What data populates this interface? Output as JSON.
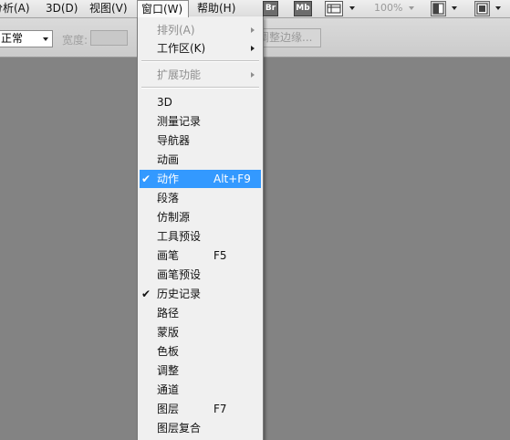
{
  "menubar": {
    "items": [
      {
        "label": "分析(A)"
      },
      {
        "label": "3D(D)"
      },
      {
        "label": "视图(V)"
      },
      {
        "label": "窗口(W)"
      },
      {
        "label": "帮助(H)"
      }
    ],
    "bridge_label": "Br",
    "minibridge_label": "Mb",
    "zoom_value": "100%"
  },
  "optionsbar": {
    "style_value": "正常",
    "width_label": "宽度:",
    "refine_edge_label": "调整边缘..."
  },
  "window_menu": {
    "top_items": [
      {
        "label": "排列(A)",
        "disabled": true,
        "submenu": true
      },
      {
        "label": "工作区(K)",
        "disabled": false,
        "submenu": true
      }
    ],
    "extension_item": {
      "label": "扩展功能",
      "disabled": true,
      "submenu": true
    },
    "panel_items": [
      {
        "label": "3D",
        "shortcut": "",
        "checked": false
      },
      {
        "label": "测量记录",
        "shortcut": "",
        "checked": false
      },
      {
        "label": "导航器",
        "shortcut": "",
        "checked": false
      },
      {
        "label": "动画",
        "shortcut": "",
        "checked": false
      },
      {
        "label": "动作",
        "shortcut": "Alt+F9",
        "checked": true,
        "highlighted": true
      },
      {
        "label": "段落",
        "shortcut": "",
        "checked": false
      },
      {
        "label": "仿制源",
        "shortcut": "",
        "checked": false
      },
      {
        "label": "工具预设",
        "shortcut": "",
        "checked": false
      },
      {
        "label": "画笔",
        "shortcut": "F5",
        "checked": false
      },
      {
        "label": "画笔预设",
        "shortcut": "",
        "checked": false
      },
      {
        "label": "历史记录",
        "shortcut": "",
        "checked": true
      },
      {
        "label": "路径",
        "shortcut": "",
        "checked": false
      },
      {
        "label": "蒙版",
        "shortcut": "",
        "checked": false
      },
      {
        "label": "色板",
        "shortcut": "",
        "checked": false
      },
      {
        "label": "调整",
        "shortcut": "",
        "checked": false
      },
      {
        "label": "通道",
        "shortcut": "",
        "checked": false
      },
      {
        "label": "图层",
        "shortcut": "F7",
        "checked": false
      },
      {
        "label": "图层复合",
        "shortcut": "",
        "checked": false
      }
    ],
    "check_glyph": "✔"
  },
  "colors": {
    "highlight": "#3399ff",
    "workspace": "#838383"
  }
}
